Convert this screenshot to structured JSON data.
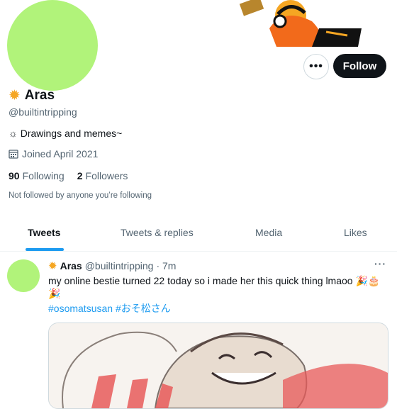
{
  "profile": {
    "name": "Aras",
    "handle": "@builtintripping",
    "bio": "☼ Drawings and memes~",
    "joined": "Joined April 2021",
    "following_count": "90",
    "following_label": "Following",
    "followers_count": "2",
    "followers_label": "Followers",
    "not_followed": "Not followed by anyone you’re following",
    "avatar_color": "#b1f37a"
  },
  "actions": {
    "more": "•••",
    "follow": "Follow"
  },
  "tabs": [
    "Tweets",
    "Tweets & replies",
    "Media",
    "Likes"
  ],
  "tweet": {
    "name": "Aras",
    "handle": "@builtintripping",
    "time": "· 7m",
    "text": "my online bestie turned 22 today so i made her this quick thing lmaoo",
    "emojis": "🎉🎂🎉",
    "hashtags": "#osomatsusan #おそ松さん",
    "more": "···"
  },
  "colors": {
    "accent": "#1d9bf0",
    "text": "#0f1419",
    "muted": "#536471",
    "follow_bg": "#0f1419"
  },
  "icons": [
    "sun-icon",
    "calendar-icon",
    "more-icon"
  ]
}
